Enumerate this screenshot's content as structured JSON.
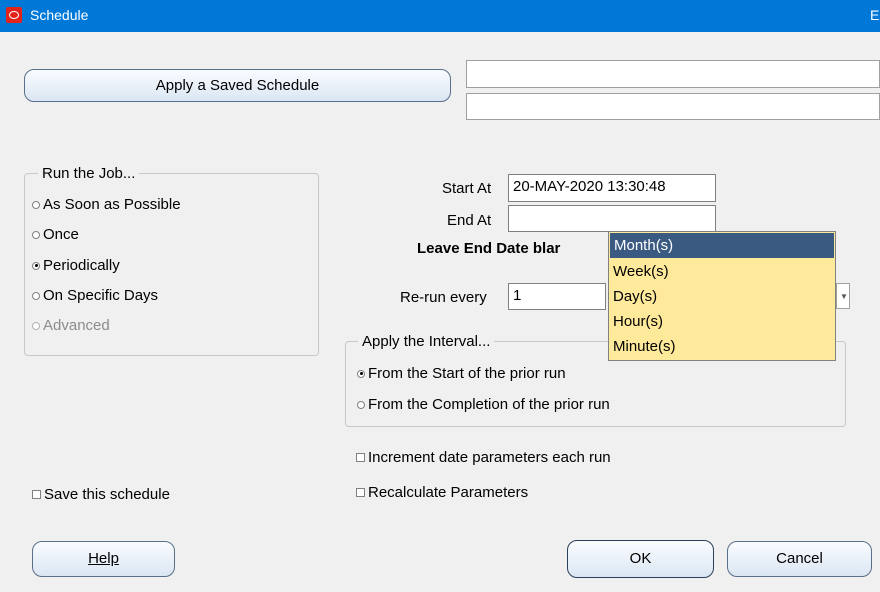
{
  "window": {
    "title": "Schedule",
    "title_extra": "E"
  },
  "saved_schedule": {
    "button_label": "Apply a Saved Schedule",
    "field1": "",
    "field2": ""
  },
  "run_job": {
    "legend": "Run the Job...",
    "options": [
      {
        "label": "As Soon as Possible",
        "selected": false,
        "enabled": true
      },
      {
        "label": "Once",
        "selected": false,
        "enabled": true
      },
      {
        "label": "Periodically",
        "selected": true,
        "enabled": true
      },
      {
        "label": "On Specific Days",
        "selected": false,
        "enabled": true
      },
      {
        "label": "Advanced",
        "selected": false,
        "enabled": false
      }
    ]
  },
  "timing": {
    "start_label": "Start At",
    "start_value": "20-MAY-2020 13:30:48",
    "end_label": "End At",
    "end_value": "",
    "hint": "Leave End Date blar",
    "rerun_label": "Re-run every",
    "rerun_value": "1"
  },
  "unit_dropdown": {
    "options": [
      "Month(s)",
      "Week(s)",
      "Day(s)",
      "Hour(s)",
      "Minute(s)"
    ],
    "selected_index": 0
  },
  "interval": {
    "legend": "Apply the Interval...",
    "options": [
      {
        "label": "From the Start of the prior run",
        "selected": true
      },
      {
        "label": "From the Completion of the prior run",
        "selected": false
      }
    ]
  },
  "checkboxes": {
    "increment": "Increment date parameters each run",
    "recalculate": "Recalculate Parameters",
    "save": "Save this schedule"
  },
  "buttons": {
    "help": "Help",
    "ok": "OK",
    "cancel": "Cancel"
  },
  "colors": {
    "titlebar": "#0078d7",
    "dropdown_bg": "#ffe99b",
    "dropdown_selected": "#3a5a82"
  }
}
